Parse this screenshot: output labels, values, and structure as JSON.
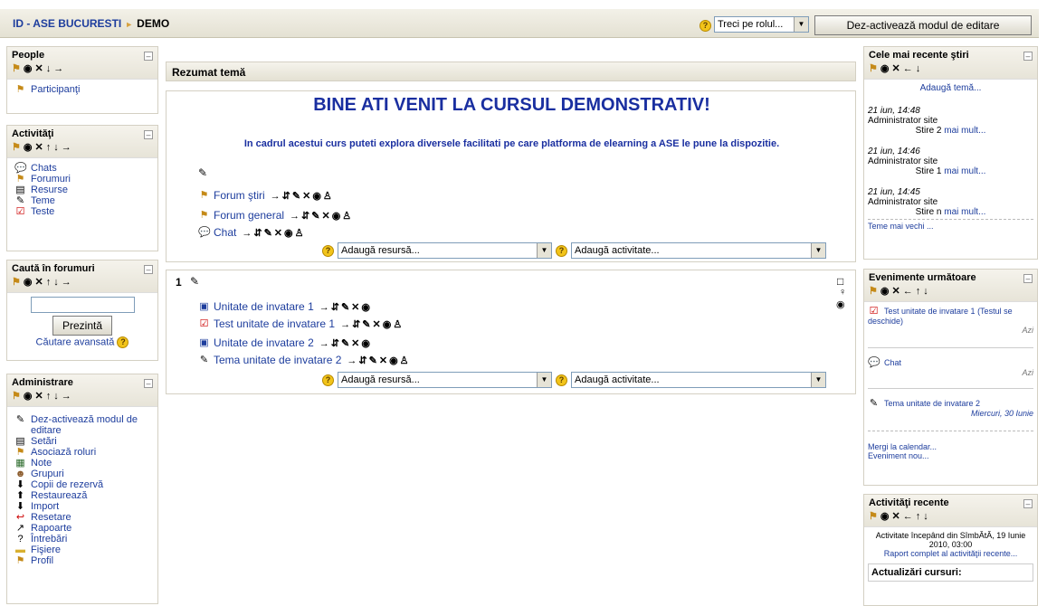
{
  "topbar": {
    "crumb_site": "ID - ASE BUCURESTI",
    "crumb_sep": "►",
    "crumb_course": "DEMO",
    "role_select": "Treci pe rolul...",
    "edit_button": "Dez-activează modul de editare"
  },
  "tools": {
    "move_icon": "move-icon",
    "controls_a": "⇥ ◉ ✕ ↓ →",
    "controls_b": "⇥ ◉ ✕ ↑ ↓ →"
  },
  "people": {
    "title": "People",
    "participants": "Participanţi"
  },
  "activities": {
    "title": "Activităţi",
    "items": [
      "Chats",
      "Forumuri",
      "Resurse",
      "Teme",
      "Teste"
    ]
  },
  "search": {
    "title": "Caută în forumuri",
    "button": "Prezintă",
    "advanced": "Căutare avansată"
  },
  "admin": {
    "title": "Administrare",
    "items": [
      "Dez-activează modul de editare",
      "Setări",
      "Asociază roluri",
      "Note",
      "Grupuri",
      "Copii de rezervă",
      "Restaurează",
      "Import",
      "Resetare",
      "Rapoarte",
      "Întrebări",
      "Fişiere",
      "Profil"
    ]
  },
  "main": {
    "summary_title": "Rezumat temă",
    "welcome": "BINE ATI VENIT LA CURSUL DEMONSTRATIV!",
    "intro": "In cadrul acestui curs puteti explora diversele facilitati pe care platforma de elearning a ASE le pune la dispozitie.",
    "section0": [
      "Forum ştiri",
      "Forum general",
      "Chat"
    ],
    "add_resource": "Adaugă resursă...",
    "add_activity": "Adaugă activitate...",
    "section1_num": "1",
    "section1": [
      "Unitate de invatare 1",
      "Test unitate de invatare 1",
      "Unitate de invatare 2",
      "Tema unitate de invatare 2"
    ]
  },
  "news": {
    "title": "Cele mai recente ştiri",
    "add": "Adaugă temă...",
    "items": [
      {
        "date": "21 iun, 14:48",
        "author": "Administrator site",
        "text": "Stire 2",
        "more": "mai mult..."
      },
      {
        "date": "21 iun, 14:46",
        "author": "Administrator site",
        "text": "Stire 1",
        "more": "mai mult..."
      },
      {
        "date": "21 iun, 14:45",
        "author": "Administrator site",
        "text": "Stire n",
        "more": "mai mult..."
      }
    ],
    "older": "Teme mai vechi ..."
  },
  "events": {
    "title": "Evenimente următoare",
    "items": [
      {
        "name": "Test unitate de invatare 1 (Testul se deschide)",
        "when": "Azi"
      },
      {
        "name": "Chat",
        "when": "Azi"
      },
      {
        "name": "Tema unitate de invatare 2",
        "when": "Miercuri, 30 Iunie"
      }
    ],
    "calendar": "Mergi la calendar...",
    "new_event": "Eveniment nou..."
  },
  "recent": {
    "title": "Activităţi recente",
    "since": "Activitate începând din SîmbĂtĂ, 19 Iunie 2010, 03:00",
    "report": "Raport complet al activităţii recente...",
    "updates": "Actualizări cursuri:"
  },
  "colors": {
    "link": "#1d3d9d",
    "heading_blue": "#1a2fa0"
  }
}
